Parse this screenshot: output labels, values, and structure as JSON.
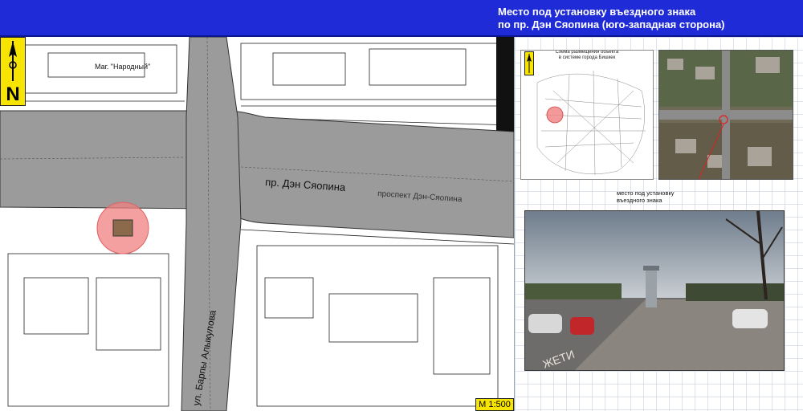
{
  "header": {
    "title_line1": "Место под установку въездного знака",
    "title_line2": "по пр. Дэн Сяопина (юго-западная сторона)",
    "background": "#1f2bd6"
  },
  "map": {
    "north_letter": "N",
    "scale": "M 1:500",
    "street_main": "пр. Дэн Сяопина",
    "street_main_plan": "проспект Дэн-Сяопина",
    "street_cross": "ул. Барпы Алыкулова",
    "shop_label": "Маг. \"Народный\"",
    "site_marker_color": "#f08080"
  },
  "city_scheme": {
    "caption_line1": "Схема размещения объекта",
    "caption_line2": "в системе города Бишкек"
  },
  "satellite": {
    "annotation_line1": "место под установку",
    "annotation_line2": "въездного знака"
  },
  "photo": {
    "road_text": "ЖЕТИ"
  }
}
